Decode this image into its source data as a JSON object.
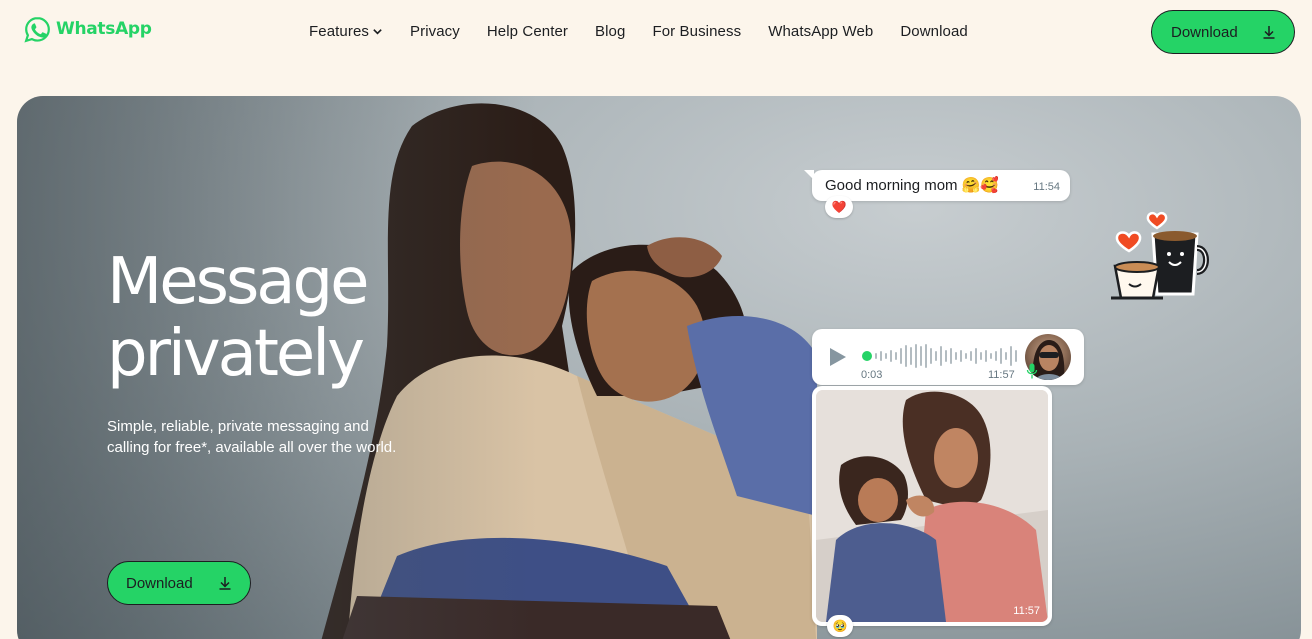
{
  "brand": {
    "name": "WhatsApp",
    "color": "#25d366"
  },
  "nav": {
    "items": [
      {
        "label": "Features",
        "has_dropdown": true
      },
      {
        "label": "Privacy"
      },
      {
        "label": "Help Center"
      },
      {
        "label": "Blog"
      },
      {
        "label": "For Business"
      },
      {
        "label": "WhatsApp Web"
      },
      {
        "label": "Download"
      }
    ],
    "download_button": {
      "label": "Download",
      "icon": "download-icon"
    }
  },
  "hero": {
    "title_line1": "Message",
    "title_line2": "privately",
    "subtitle": "Simple, reliable, private messaging and calling for free*, available all over the world.",
    "download_button": {
      "label": "Download",
      "icon": "download-icon"
    }
  },
  "chat": {
    "text_message": {
      "text": "Good morning mom 🤗🥰",
      "time": "11:54",
      "reaction": "❤️"
    },
    "voice_message": {
      "duration": "0:03",
      "time": "11:57"
    },
    "photo_message": {
      "time": "11:57",
      "reaction": "🥹"
    }
  },
  "colors": {
    "page_background": "#fcf5eb",
    "accent_green": "#25d366",
    "text_dark": "#1c1e21"
  }
}
